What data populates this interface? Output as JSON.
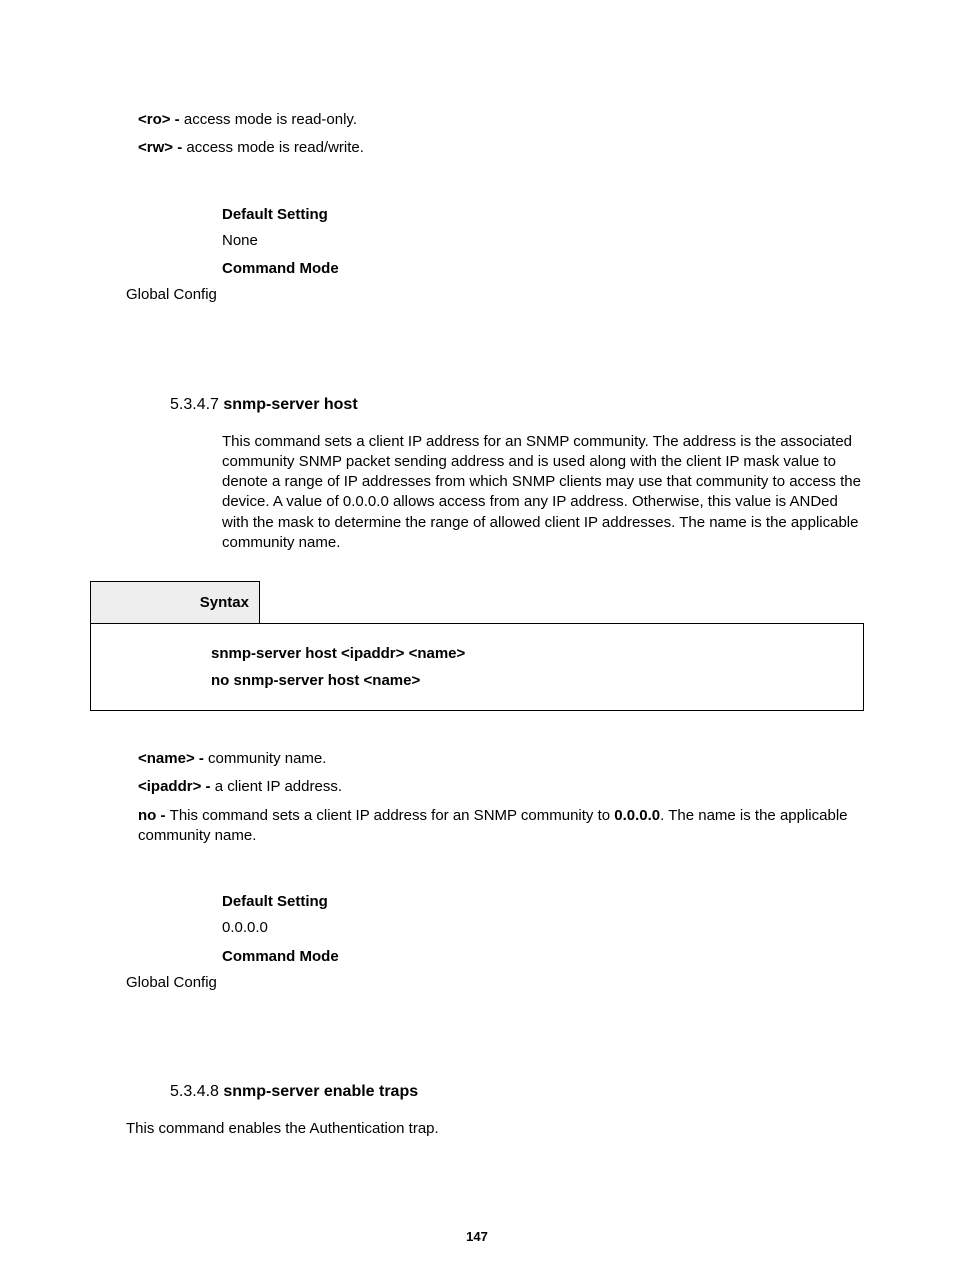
{
  "topParams": {
    "ro": {
      "tag": "<ro> - ",
      "desc": "access mode is read-only."
    },
    "rw": {
      "tag": "<rw> - ",
      "desc": "access mode is read/write."
    }
  },
  "topSettings": {
    "defaultLabel": "Default Setting",
    "defaultValue": "None",
    "modeLabel": "Command Mode",
    "modeValue": "Global Config"
  },
  "section547": {
    "num": "5.3.4.7 ",
    "title": "snmp-server host",
    "desc": "This command sets a client IP address for an SNMP community. The address is the associated community SNMP packet sending address and is used along with the client IP mask value to denote a range of IP addresses from which SNMP clients may use that community to access the device. A value of 0.0.0.0 allows access from any IP address. Otherwise, this value is ANDed with the mask to determine the range of allowed client IP addresses. The name is the applicable community name.",
    "syntaxLabel": "Syntax",
    "syntaxLine1": "snmp-server host <ipaddr> <name>",
    "syntaxLine2": "no snmp-server host <name>",
    "params": {
      "name": {
        "tag": "<name> - ",
        "desc": "community name."
      },
      "ipaddr": {
        "tag": "<ipaddr> - ",
        "desc": "a client IP address."
      },
      "no": {
        "tag": "no - ",
        "descA": "This command sets a client IP address for an SNMP community to ",
        "bold": "0.0.0.0",
        "descB": ". The name is the applicable community name."
      }
    },
    "settings": {
      "defaultLabel": "Default Setting",
      "defaultValue": "0.0.0.0",
      "modeLabel": "Command Mode",
      "modeValue": "Global Config"
    }
  },
  "section548": {
    "num": "5.3.4.8 ",
    "title": "snmp-server enable traps",
    "desc": "This command enables the Authentication trap."
  },
  "pageNumber": "147"
}
